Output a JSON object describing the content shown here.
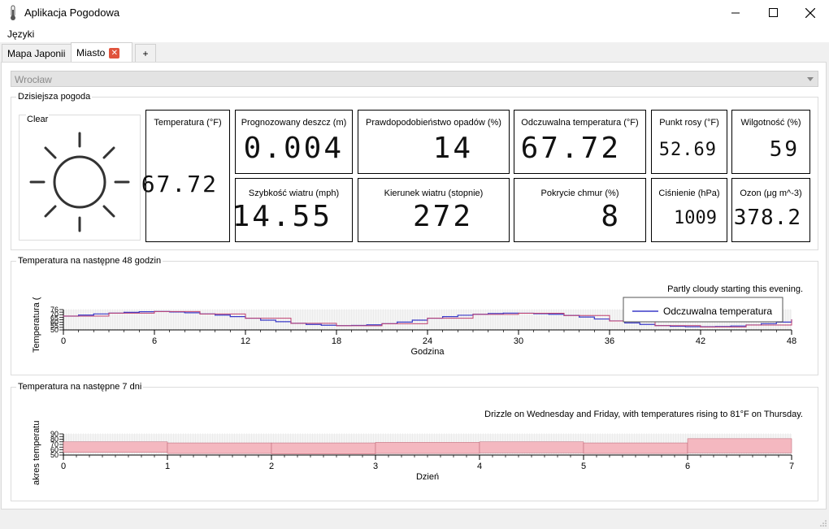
{
  "window": {
    "title": "Aplikacja Pogodowa",
    "minimize": "—",
    "maximize": "☐",
    "close": "✕"
  },
  "menubar": {
    "languages": "Języki"
  },
  "tabs": [
    {
      "label": "Mapa Japonii"
    },
    {
      "label": "Miasto"
    }
  ],
  "add_tab": "+",
  "city_select": {
    "value": "Wrocław"
  },
  "today": {
    "group_title": "Dzisiejsza pogoda",
    "condition": "Clear",
    "cards": {
      "temperature": {
        "label": "Temperatura (°F)",
        "value": "67.72"
      },
      "rain": {
        "label": "Prognozowany deszcz (m)",
        "value": "0.004"
      },
      "precip_prob": {
        "label": "Prawdopodobieństwo opadów (%)",
        "value": "14"
      },
      "feels_like": {
        "label": "Odczuwalna temperatura (°F)",
        "value": "67.72"
      },
      "dew_point": {
        "label": "Punkt rosy (°F)",
        "value": "52.69"
      },
      "humidity": {
        "label": "Wilgotność (%)",
        "value": "59"
      },
      "wind_speed": {
        "label": "Szybkość wiatru (mph)",
        "value": "14.55"
      },
      "wind_dir": {
        "label": "Kierunek wiatru (stopnie)",
        "value": "272"
      },
      "cloud_cover": {
        "label": "Pokrycie chmur (%)",
        "value": "8"
      },
      "pressure": {
        "label": "Ciśnienie (hPa)",
        "value": "1009"
      },
      "ozone": {
        "label": "Ozon (μg m^-3)",
        "value": "378.2"
      }
    }
  },
  "hourly": {
    "group_title": "Temperatura na następne 48 godzin",
    "summary": "Partly cloudy starting this evening."
  },
  "daily": {
    "group_title": "Temperatura na następne 7 dni",
    "summary": "Drizzle on Wednesday and Friday, with temperatures rising to 81°F on Thursday."
  },
  "chart_data": [
    {
      "type": "line",
      "xlabel": "Godzina",
      "ylabel": "Temperatura (",
      "xlim": [
        0,
        48
      ],
      "xticks": [
        0,
        6,
        12,
        18,
        24,
        30,
        36,
        42,
        48
      ],
      "ylim": [
        50,
        76
      ],
      "legend": "top-right",
      "series": [
        {
          "name": "Odczuwalna temperatura",
          "color": "#3a3ac8",
          "x": [
            0,
            1,
            2,
            3,
            4,
            5,
            6,
            7,
            8,
            9,
            10,
            11,
            12,
            13,
            14,
            15,
            16,
            17,
            18,
            19,
            20,
            21,
            22,
            23,
            24,
            25,
            26,
            27,
            28,
            29,
            30,
            31,
            32,
            33,
            34,
            35,
            36,
            37,
            38,
            39,
            40,
            41,
            42,
            43,
            44,
            45,
            46,
            47,
            48
          ],
          "values": [
            67.7,
            69,
            70.5,
            71.5,
            72.5,
            73.3,
            73.6,
            73,
            72,
            70.5,
            69,
            67,
            65,
            62.5,
            60.5,
            58.5,
            57,
            56,
            55.5,
            55.8,
            56.5,
            58,
            60,
            62.5,
            65,
            67,
            68.8,
            70,
            71,
            71.5,
            71.4,
            70.8,
            70,
            68.5,
            66.5,
            64,
            61.5,
            59,
            57,
            55.5,
            54.6,
            54.1,
            54,
            54.3,
            55,
            56.3,
            58,
            60,
            63
          ]
        },
        {
          "name": "",
          "color": "#c04070",
          "x": [
            0,
            3,
            6,
            9,
            12,
            15,
            18,
            21,
            24,
            27,
            30,
            33,
            36,
            39,
            42,
            45,
            48
          ],
          "values": [
            67.7,
            71.4,
            73.5,
            70.4,
            64.9,
            58.4,
            55.3,
            57.9,
            64.9,
            69.9,
            71.3,
            68.4,
            61.4,
            55.4,
            53.8,
            56.2,
            62.9
          ]
        }
      ]
    },
    {
      "type": "area",
      "xlabel": "Dzień",
      "ylabel": "akres temperatu",
      "xlim": [
        0,
        7
      ],
      "xticks": [
        0,
        1,
        2,
        3,
        4,
        5,
        6,
        7
      ],
      "ylim": [
        50,
        90
      ],
      "color": "#f4b8c0",
      "x": [
        0,
        1,
        2,
        3,
        4,
        5,
        6,
        7
      ],
      "high": [
        75,
        73,
        73,
        74,
        75,
        73,
        81,
        81
      ],
      "low": [
        55,
        53,
        52,
        53,
        54,
        53,
        54,
        54
      ]
    }
  ]
}
